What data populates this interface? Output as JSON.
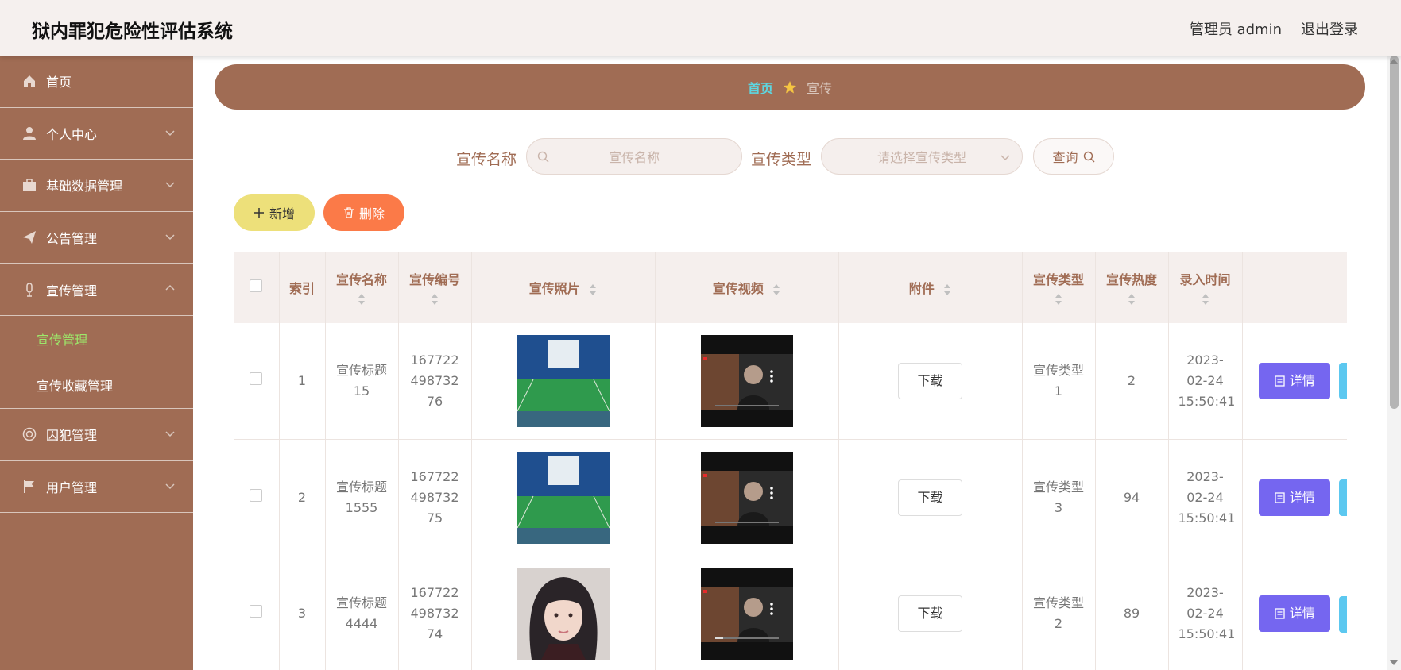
{
  "app": {
    "title": "狱内罪犯危险性评估系统",
    "user_label": "管理员 admin",
    "logout_label": "退出登录"
  },
  "sidebar": {
    "items": [
      {
        "label": "首页",
        "icon": "home-icon"
      },
      {
        "label": "个人中心",
        "icon": "user-icon"
      },
      {
        "label": "基础数据管理",
        "icon": "briefcase-icon"
      },
      {
        "label": "公告管理",
        "icon": "send-icon"
      },
      {
        "label": "宣传管理",
        "icon": "mic-icon",
        "expanded": true,
        "children": [
          {
            "label": "宣传管理",
            "active": true
          },
          {
            "label": "宣传收藏管理",
            "active": false
          }
        ]
      },
      {
        "label": "囚犯管理",
        "icon": "lifebuoy-icon"
      },
      {
        "label": "用户管理",
        "icon": "flag-icon"
      }
    ]
  },
  "breadcrumb": {
    "home": "首页",
    "current": "宣传"
  },
  "search": {
    "name_label": "宣传名称",
    "name_placeholder": "宣传名称",
    "type_label": "宣传类型",
    "type_placeholder": "请选择宣传类型",
    "query_label": "查询"
  },
  "actions": {
    "add_label": "新增",
    "delete_label": "删除"
  },
  "table": {
    "headers": {
      "index": "索引",
      "name": "宣传名称",
      "code": "宣传编号",
      "photo": "宣传照片",
      "video": "宣传视频",
      "attachment": "附件",
      "type": "宣传类型",
      "heat": "宣传热度",
      "time": "录入时间"
    },
    "download_label": "下载",
    "detail_label": "详情",
    "rows": [
      {
        "index": "1",
        "name": "宣传标题15",
        "code": "16772249873276",
        "photo": "court-photo",
        "type": "宣传类型1",
        "heat": "2",
        "time": "2023-02-24 15:50:41"
      },
      {
        "index": "2",
        "name": "宣传标题1555",
        "code": "16772249873275",
        "photo": "court-photo",
        "type": "宣传类型3",
        "heat": "94",
        "time": "2023-02-24 15:50:41"
      },
      {
        "index": "3",
        "name": "宣传标题4444",
        "code": "16772249873274",
        "photo": "portrait-photo",
        "type": "宣传类型2",
        "heat": "89",
        "time": "2023-02-24 15:50:41"
      }
    ]
  },
  "colors": {
    "brand": "#a06c54",
    "breadcrumb_home": "#5dd6e0",
    "add": "#ede07a",
    "delete": "#fb7a48",
    "detail": "#7566f0",
    "active_sub": "#9de86a"
  }
}
